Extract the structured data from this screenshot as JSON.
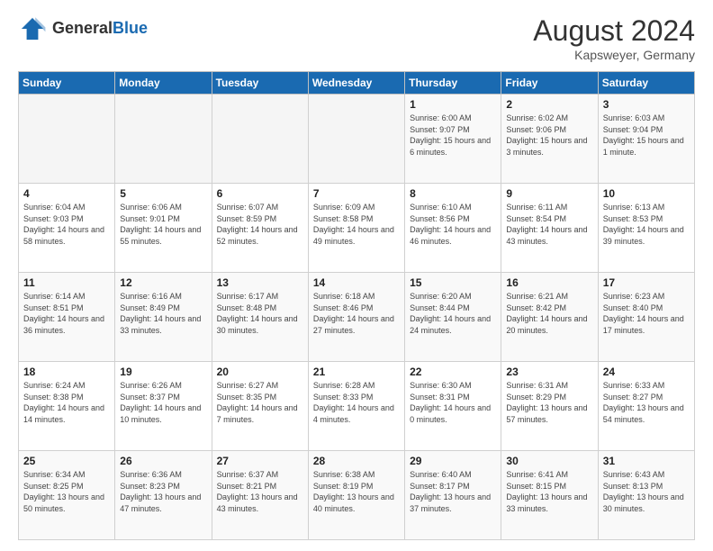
{
  "header": {
    "logo_general": "General",
    "logo_blue": "Blue",
    "month_year": "August 2024",
    "location": "Kapsweyer, Germany"
  },
  "days_of_week": [
    "Sunday",
    "Monday",
    "Tuesday",
    "Wednesday",
    "Thursday",
    "Friday",
    "Saturday"
  ],
  "weeks": [
    [
      {
        "day": "",
        "info": ""
      },
      {
        "day": "",
        "info": ""
      },
      {
        "day": "",
        "info": ""
      },
      {
        "day": "",
        "info": ""
      },
      {
        "day": "1",
        "info": "Sunrise: 6:00 AM\nSunset: 9:07 PM\nDaylight: 15 hours\nand 6 minutes."
      },
      {
        "day": "2",
        "info": "Sunrise: 6:02 AM\nSunset: 9:06 PM\nDaylight: 15 hours\nand 3 minutes."
      },
      {
        "day": "3",
        "info": "Sunrise: 6:03 AM\nSunset: 9:04 PM\nDaylight: 15 hours\nand 1 minute."
      }
    ],
    [
      {
        "day": "4",
        "info": "Sunrise: 6:04 AM\nSunset: 9:03 PM\nDaylight: 14 hours\nand 58 minutes."
      },
      {
        "day": "5",
        "info": "Sunrise: 6:06 AM\nSunset: 9:01 PM\nDaylight: 14 hours\nand 55 minutes."
      },
      {
        "day": "6",
        "info": "Sunrise: 6:07 AM\nSunset: 8:59 PM\nDaylight: 14 hours\nand 52 minutes."
      },
      {
        "day": "7",
        "info": "Sunrise: 6:09 AM\nSunset: 8:58 PM\nDaylight: 14 hours\nand 49 minutes."
      },
      {
        "day": "8",
        "info": "Sunrise: 6:10 AM\nSunset: 8:56 PM\nDaylight: 14 hours\nand 46 minutes."
      },
      {
        "day": "9",
        "info": "Sunrise: 6:11 AM\nSunset: 8:54 PM\nDaylight: 14 hours\nand 43 minutes."
      },
      {
        "day": "10",
        "info": "Sunrise: 6:13 AM\nSunset: 8:53 PM\nDaylight: 14 hours\nand 39 minutes."
      }
    ],
    [
      {
        "day": "11",
        "info": "Sunrise: 6:14 AM\nSunset: 8:51 PM\nDaylight: 14 hours\nand 36 minutes."
      },
      {
        "day": "12",
        "info": "Sunrise: 6:16 AM\nSunset: 8:49 PM\nDaylight: 14 hours\nand 33 minutes."
      },
      {
        "day": "13",
        "info": "Sunrise: 6:17 AM\nSunset: 8:48 PM\nDaylight: 14 hours\nand 30 minutes."
      },
      {
        "day": "14",
        "info": "Sunrise: 6:18 AM\nSunset: 8:46 PM\nDaylight: 14 hours\nand 27 minutes."
      },
      {
        "day": "15",
        "info": "Sunrise: 6:20 AM\nSunset: 8:44 PM\nDaylight: 14 hours\nand 24 minutes."
      },
      {
        "day": "16",
        "info": "Sunrise: 6:21 AM\nSunset: 8:42 PM\nDaylight: 14 hours\nand 20 minutes."
      },
      {
        "day": "17",
        "info": "Sunrise: 6:23 AM\nSunset: 8:40 PM\nDaylight: 14 hours\nand 17 minutes."
      }
    ],
    [
      {
        "day": "18",
        "info": "Sunrise: 6:24 AM\nSunset: 8:38 PM\nDaylight: 14 hours\nand 14 minutes."
      },
      {
        "day": "19",
        "info": "Sunrise: 6:26 AM\nSunset: 8:37 PM\nDaylight: 14 hours\nand 10 minutes."
      },
      {
        "day": "20",
        "info": "Sunrise: 6:27 AM\nSunset: 8:35 PM\nDaylight: 14 hours\nand 7 minutes."
      },
      {
        "day": "21",
        "info": "Sunrise: 6:28 AM\nSunset: 8:33 PM\nDaylight: 14 hours\nand 4 minutes."
      },
      {
        "day": "22",
        "info": "Sunrise: 6:30 AM\nSunset: 8:31 PM\nDaylight: 14 hours\nand 0 minutes."
      },
      {
        "day": "23",
        "info": "Sunrise: 6:31 AM\nSunset: 8:29 PM\nDaylight: 13 hours\nand 57 minutes."
      },
      {
        "day": "24",
        "info": "Sunrise: 6:33 AM\nSunset: 8:27 PM\nDaylight: 13 hours\nand 54 minutes."
      }
    ],
    [
      {
        "day": "25",
        "info": "Sunrise: 6:34 AM\nSunset: 8:25 PM\nDaylight: 13 hours\nand 50 minutes."
      },
      {
        "day": "26",
        "info": "Sunrise: 6:36 AM\nSunset: 8:23 PM\nDaylight: 13 hours\nand 47 minutes."
      },
      {
        "day": "27",
        "info": "Sunrise: 6:37 AM\nSunset: 8:21 PM\nDaylight: 13 hours\nand 43 minutes."
      },
      {
        "day": "28",
        "info": "Sunrise: 6:38 AM\nSunset: 8:19 PM\nDaylight: 13 hours\nand 40 minutes."
      },
      {
        "day": "29",
        "info": "Sunrise: 6:40 AM\nSunset: 8:17 PM\nDaylight: 13 hours\nand 37 minutes."
      },
      {
        "day": "30",
        "info": "Sunrise: 6:41 AM\nSunset: 8:15 PM\nDaylight: 13 hours\nand 33 minutes."
      },
      {
        "day": "31",
        "info": "Sunrise: 6:43 AM\nSunset: 8:13 PM\nDaylight: 13 hours\nand 30 minutes."
      }
    ]
  ]
}
